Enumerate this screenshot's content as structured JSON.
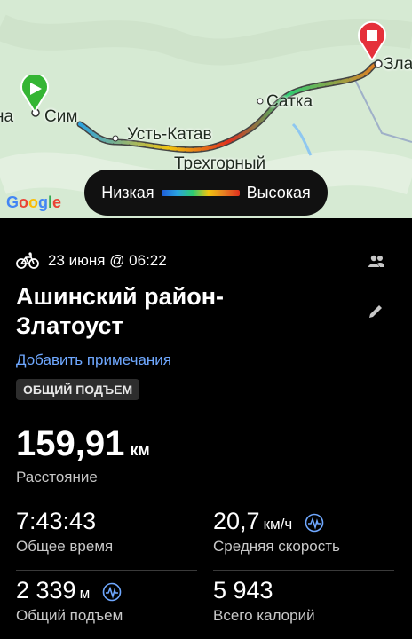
{
  "map": {
    "towns": [
      "Сим",
      "Усть-Катав",
      "Трехгорный",
      "Сатка",
      "Зла"
    ],
    "legend_low": "Низкая",
    "legend_high": "Высокая",
    "google_logo": "Google",
    "start_icon": "play-icon",
    "finish_icon": "stop-icon",
    "legend_colors": [
      "#1e5bd9",
      "#2aa3e0",
      "#2ecc71",
      "#f1c40f",
      "#e67e22",
      "#e0301e"
    ]
  },
  "activity": {
    "type_icon": "bicycle-icon",
    "date": "23 июня @ 06:22",
    "title_line1": "Ашинский район-",
    "title_line2": "Златоуст",
    "add_note": "Добавить примечания",
    "badge": "ОБЩИЙ ПОДЪЕМ"
  },
  "stats": {
    "distance_value": "159,91",
    "distance_unit": "км",
    "distance_label": "Расстояние",
    "time_value": "7:43:43",
    "time_label": "Общее время",
    "speed_value": "20,7",
    "speed_unit": "км/ч",
    "speed_label": "Средняя скорость",
    "ascent_value": "2 339",
    "ascent_unit": "м",
    "ascent_label": "Общий подъем",
    "calories_value": "5 943",
    "calories_label": "Всего калорий"
  },
  "colors": {
    "link": "#6fa8ff",
    "background": "#000000"
  }
}
